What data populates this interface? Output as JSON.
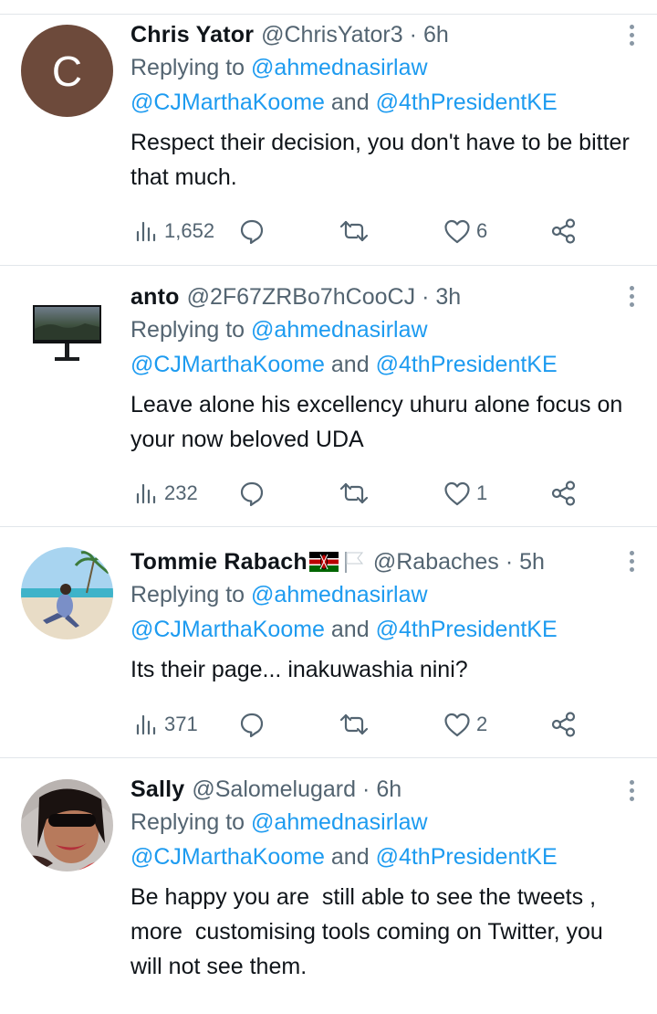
{
  "tweets": [
    {
      "name": "Chris Yator",
      "handle": "@ChrisYator3",
      "separator": "·",
      "time": "6h",
      "avatar_letter": "C",
      "replying_prefix": "Replying to ",
      "reply_to_1": "@ahmednasirlaw",
      "reply_to_2": "@CJMarthaKoome",
      "reply_and": " and ",
      "reply_to_3": "@4thPresidentKE",
      "body": "Respect their decision, you don't have to be bitter that much.",
      "views": "1,652",
      "likes": "6"
    },
    {
      "name": "anto",
      "handle": "@2F67ZRBo7hCooCJ",
      "separator": "·",
      "time": "3h",
      "avatar_desc": "monitor-avatar",
      "replying_prefix": "Replying to ",
      "reply_to_1": "@ahmednasirlaw",
      "reply_to_2": "@CJMarthaKoome",
      "reply_and": " and ",
      "reply_to_3": "@4thPresidentKE",
      "body": "Leave alone his excellency uhuru alone focus on your now beloved UDA",
      "views": "232",
      "likes": "1"
    },
    {
      "name": "Tommie Rabach",
      "handle": "@Rabaches",
      "separator": "·",
      "time": "5h",
      "avatar_desc": "beach-photo-avatar",
      "replying_prefix": "Replying to ",
      "reply_to_1": "@ahmednasirlaw",
      "reply_to_2": "@CJMarthaKoome",
      "reply_and": " and ",
      "reply_to_3": "@4thPresidentKE",
      "body": "Its their page... inakuwashia nini?",
      "views": "371",
      "likes": "2"
    },
    {
      "name": "Sally",
      "handle": "@Salomelugard",
      "separator": "·",
      "time": "6h",
      "avatar_desc": "selfie-avatar",
      "replying_prefix": "Replying to ",
      "reply_to_1": "@ahmednasirlaw",
      "reply_to_2": "@CJMarthaKoome",
      "reply_and": " and ",
      "reply_to_3": "@4thPresidentKE",
      "body": "Be happy you are  still able to see the tweets , more  customising tools coming on Twitter, you will not see them."
    }
  ],
  "colors": {
    "link": "#1d9bf0",
    "secondary_text": "#536471",
    "primary_text": "#0f1419",
    "divider": "#e1e6ea"
  },
  "icons": [
    "views-icon",
    "reply-icon",
    "retweet-icon",
    "like-icon",
    "share-icon",
    "more-options-icon"
  ]
}
